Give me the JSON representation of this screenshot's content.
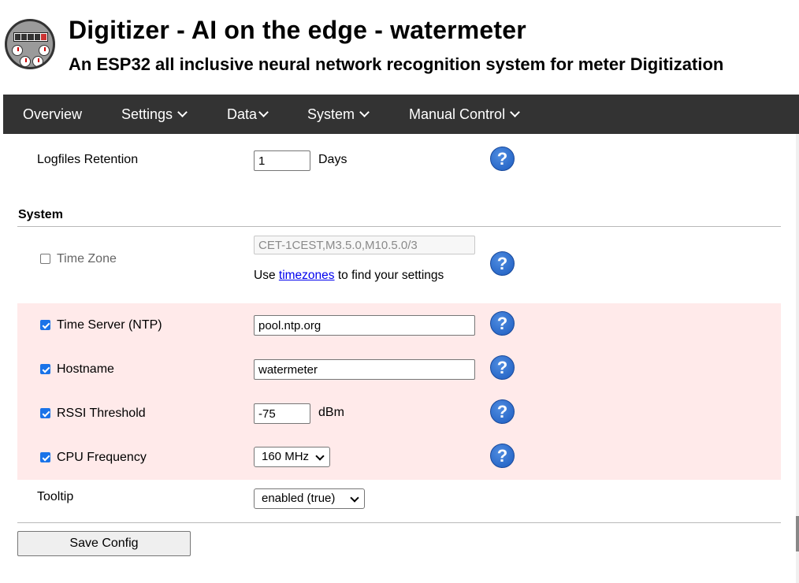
{
  "header": {
    "title": "Digitizer - AI on the edge - watermeter",
    "subtitle": "An ESP32 all inclusive neural network recognition system for meter Digitization",
    "logo_icon": "watermeter-logo"
  },
  "nav": {
    "items": [
      {
        "label": "Overview",
        "dropdown": false
      },
      {
        "label": "Settings",
        "dropdown": true
      },
      {
        "label": "Data",
        "dropdown": true
      },
      {
        "label": "System",
        "dropdown": true
      },
      {
        "label": "Manual Control",
        "dropdown": true
      }
    ]
  },
  "logfiles": {
    "label": "Logfiles Retention",
    "value": "1",
    "unit": "Days"
  },
  "system_section": {
    "title": "System",
    "timezone": {
      "label": "Time Zone",
      "checked": false,
      "value": "CET-1CEST,M3.5.0,M10.5.0/3",
      "hint_prefix": "Use",
      "hint_link": "timezones",
      "hint_suffix": "to find your settings"
    },
    "ntp": {
      "label": "Time Server (NTP)",
      "checked": true,
      "value": "pool.ntp.org"
    },
    "hostname": {
      "label": "Hostname",
      "checked": true,
      "value": "watermeter"
    },
    "rssi": {
      "label": "RSSI Threshold",
      "checked": true,
      "value": "-75",
      "unit": "dBm"
    },
    "cpu": {
      "label": "CPU Frequency",
      "checked": true,
      "value": "160 MHz"
    },
    "tooltip": {
      "label": "Tooltip",
      "value": "enabled (true)"
    }
  },
  "actions": {
    "save_label": "Save Config"
  },
  "help_icon": {
    "glyph": "?",
    "name": "help-icon"
  },
  "colors": {
    "nav_bg": "#333333",
    "highlight_bg": "#ffeaea",
    "help_blue": "#1c5cc0",
    "checkbox_blue": "#1a73e8"
  }
}
